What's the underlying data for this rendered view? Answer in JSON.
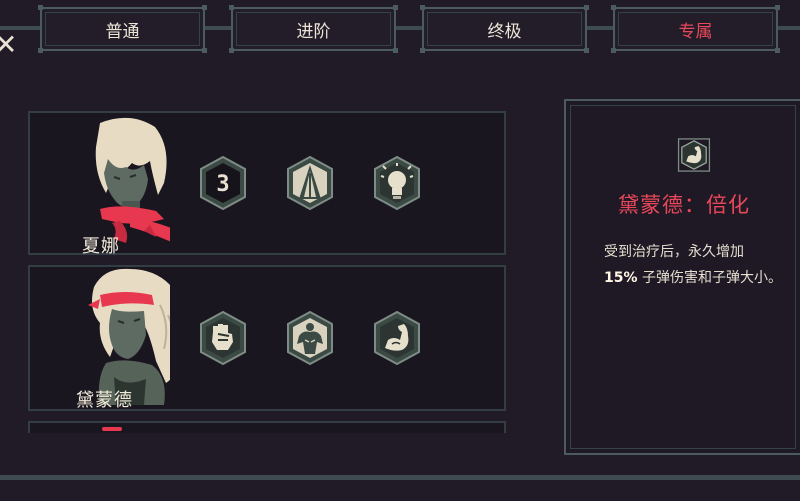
{
  "tabs": [
    {
      "label": "普通",
      "active": false
    },
    {
      "label": "进阶",
      "active": false
    },
    {
      "label": "终极",
      "active": false
    },
    {
      "label": "专属",
      "active": true
    }
  ],
  "characters": [
    {
      "name": "夏娜",
      "perks": [
        "number-3-hex-icon",
        "spike-tree-hex-icon",
        "lightbulb-hex-icon"
      ]
    },
    {
      "name": "黛蒙德",
      "perks": [
        "fist-hex-icon",
        "muscle-body-hex-icon",
        "flexed-arm-hex-icon"
      ]
    }
  ],
  "detail": {
    "icon": "flexed-arm-hex-icon",
    "title": "黛蒙德：倍化",
    "desc_before": "受到治疗后，永久增加",
    "desc_highlight": "15%",
    "desc_after": " 子弹伤害和子弹大小。"
  },
  "perk_number": "3",
  "colors": {
    "accent": "#e9485a",
    "border": "#4c5b60",
    "background": "#211b27",
    "icon_fill": "#3b4a44",
    "icon_light": "#e9e2d2"
  }
}
